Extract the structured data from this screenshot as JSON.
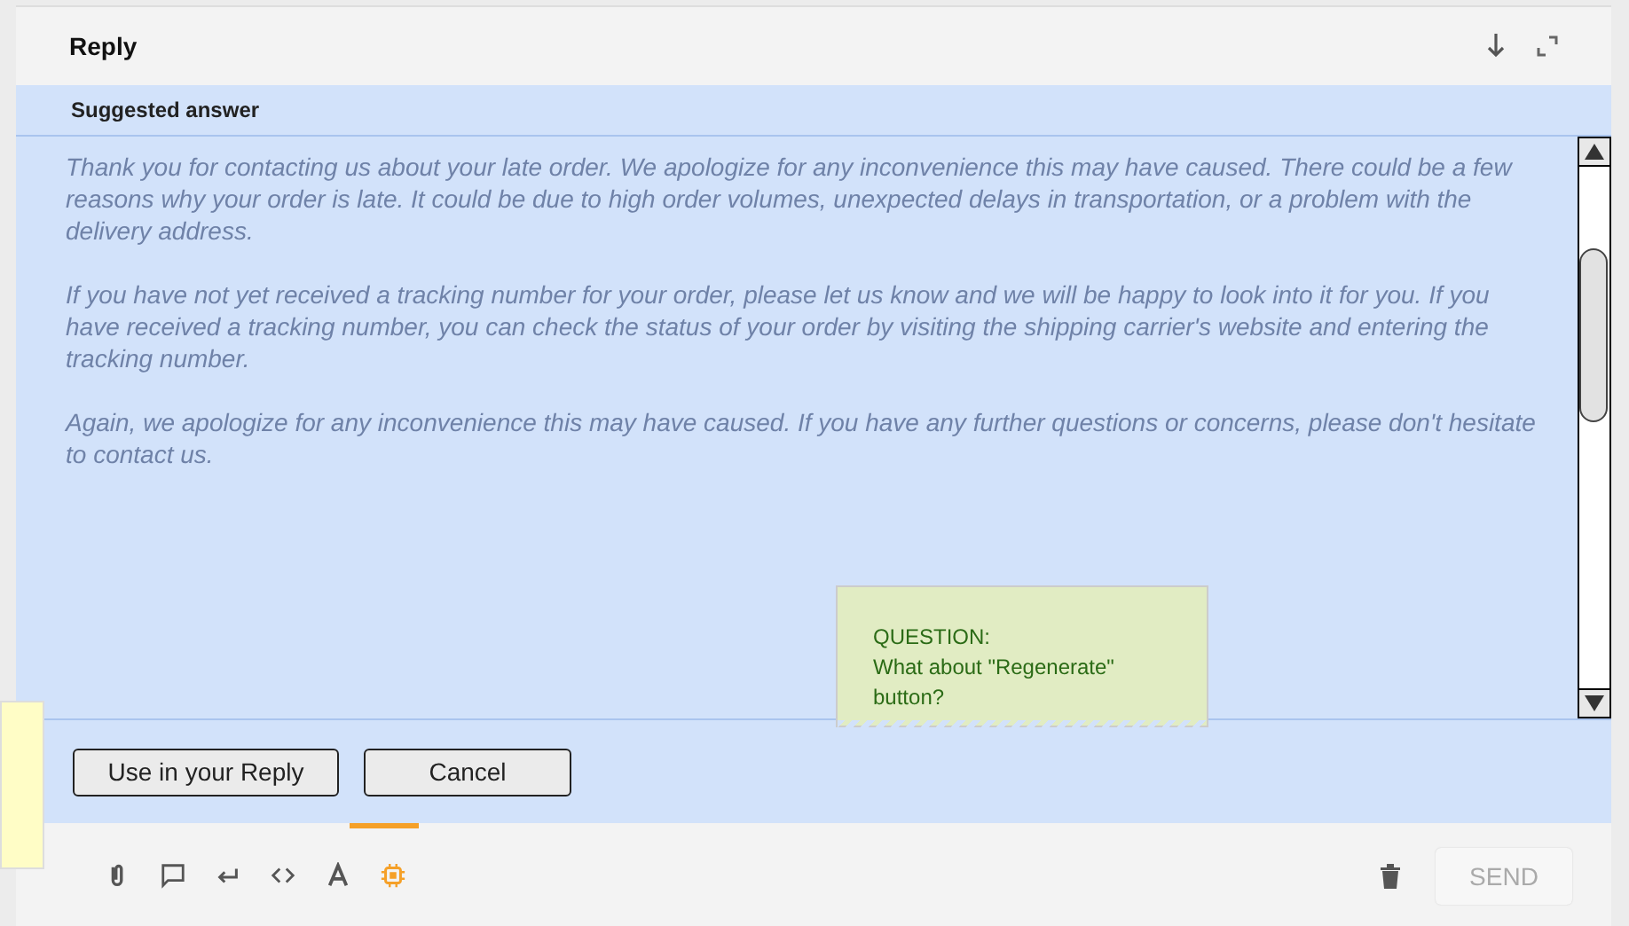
{
  "header": {
    "title": "Reply"
  },
  "suggestion": {
    "title": "Suggested answer",
    "paragraphs": [
      "Thank you for contacting us about your late order. We apologize for any inconvenience this may have caused. There could be a few reasons why your order is late. It could be due to high order volumes, unexpected delays in transportation, or a problem with the delivery address.",
      "If you have not yet received a tracking number for your order, please let us know and we will be happy to look into it for you. If you have received a tracking number, you can check the status of your order by visiting the shipping carrier's website and entering the tracking number.",
      "Again, we apologize for any inconvenience this may have caused. If you have any further questions or concerns, please don't hesitate to contact us."
    ]
  },
  "buttons": [
    "Use in your Reply",
    "Cancel"
  ],
  "toolbar": {
    "tools": [
      {
        "kind": "attach",
        "selected": false
      },
      {
        "kind": "comment",
        "selected": false
      },
      {
        "kind": "return",
        "selected": false
      },
      {
        "kind": "code",
        "selected": false
      },
      {
        "kind": "font",
        "selected": false
      },
      {
        "kind": "ai",
        "selected": true
      }
    ],
    "send": {
      "label": "SEND",
      "disabled": true
    }
  },
  "note": {
    "lines": [
      "QUESTION:",
      "What about \"Regenerate\"",
      "button?"
    ]
  }
}
